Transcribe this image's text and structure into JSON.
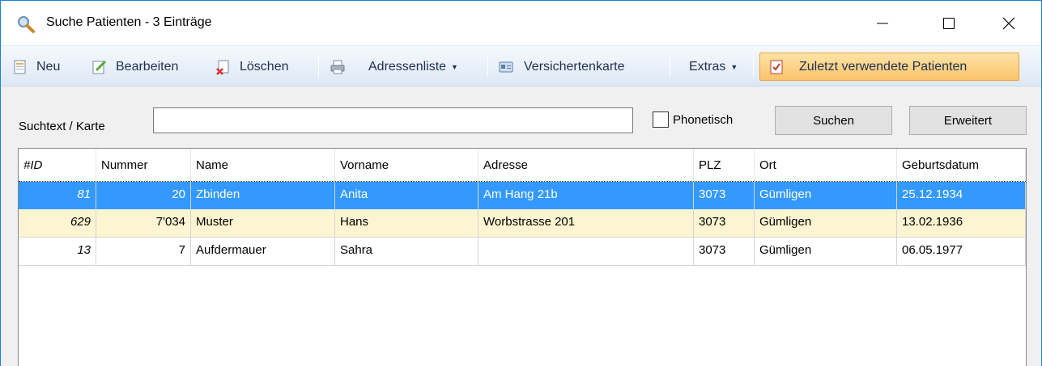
{
  "window": {
    "title": "Suche Patienten - 3 Einträge",
    "icons": {
      "app": "search-magnifier-icon",
      "minimize": "minimize-icon",
      "maximize": "maximize-icon",
      "close": "close-icon"
    }
  },
  "toolbar": {
    "new_label": "Neu",
    "edit_label": "Bearbeiten",
    "delete_label": "Löschen",
    "address_list_label": "Adressenliste",
    "insurance_card_label": "Versichertenkarte",
    "extras_label": "Extras",
    "recent_patients_label": "Zuletzt verwendete Patienten",
    "highlight_color": "#fbc36c"
  },
  "search": {
    "label": "Suchtext / Karte",
    "value": "",
    "phonetic_label": "Phonetisch",
    "phonetic_checked": false,
    "search_button": "Suchen",
    "advanced_button": "Erweitert"
  },
  "grid": {
    "columns": [
      "#ID",
      "Nummer",
      "Name",
      "Vorname",
      "Adresse",
      "PLZ",
      "Ort",
      "Geburtsdatum"
    ],
    "rows": [
      {
        "id": "81",
        "nummer": "20",
        "name": "Zbinden",
        "vorname": "Anita",
        "adresse": "Am Hang 21b",
        "plz": "3073",
        "ort": "Gümligen",
        "geburtsdatum": "25.12.1934",
        "state": "selected"
      },
      {
        "id": "629",
        "nummer": "7'034",
        "name": "Muster",
        "vorname": "Hans",
        "adresse": "Worbstrasse 201",
        "plz": "3073",
        "ort": "Gümligen",
        "geburtsdatum": "13.02.1936",
        "state": "highlighted"
      },
      {
        "id": "13",
        "nummer": "7",
        "name": "Aufdermauer",
        "vorname": "Sahra",
        "adresse": "",
        "plz": "3073",
        "ort": "Gümligen",
        "geburtsdatum": "06.05.1977",
        "state": "normal"
      }
    ],
    "colors": {
      "selected": "#3399ff",
      "highlighted": "#fdf4d2"
    }
  }
}
